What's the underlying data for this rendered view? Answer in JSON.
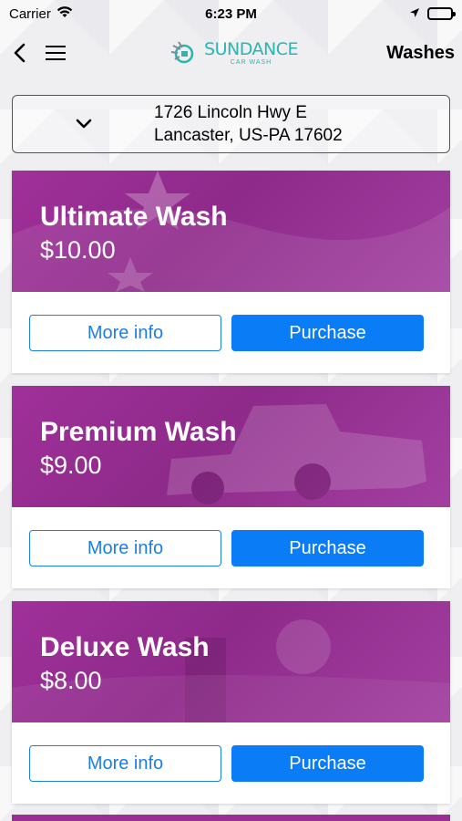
{
  "status_bar": {
    "carrier": "Carrier",
    "time": "6:23 PM",
    "icons": [
      "wifi-icon",
      "location-arrow-icon",
      "battery-icon"
    ]
  },
  "nav": {
    "back_icon": "chevron-left-icon",
    "menu_icon": "hamburger-menu-icon",
    "logo_main": "SUNDANCE",
    "logo_sub": "CAR WASH",
    "title": "Washes"
  },
  "location": {
    "chevron_icon": "chevron-down-icon",
    "address_line1": "1726 Lincoln Hwy E",
    "address_line2": "Lancaster, US-PA  17602"
  },
  "washes": [
    {
      "name": "Ultimate Wash",
      "price": "$10.00",
      "more_label": "More info",
      "purchase_label": "Purchase"
    },
    {
      "name": "Premium Wash",
      "price": "$9.00",
      "more_label": "More info",
      "purchase_label": "Purchase"
    },
    {
      "name": "Deluxe Wash",
      "price": "$8.00",
      "more_label": "More info",
      "purchase_label": "Purchase"
    }
  ],
  "colors": {
    "accent": "#0a7cf5",
    "banner": "#9a2e95",
    "logo": "#2bb5b2"
  }
}
